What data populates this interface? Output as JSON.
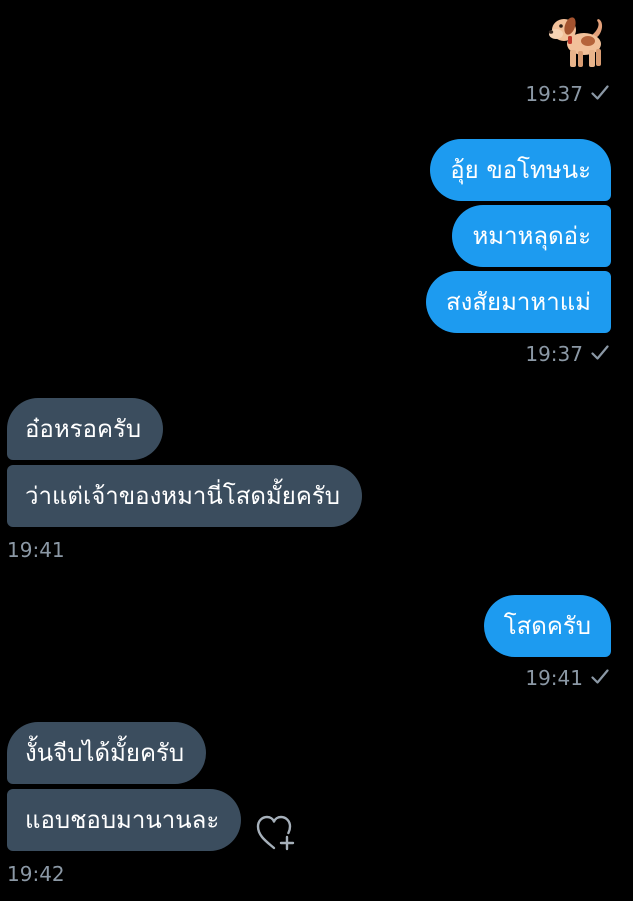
{
  "sticker": {
    "icon": "dog-emoji-icon"
  },
  "groups": [
    {
      "time": "19:37",
      "read": true
    },
    {
      "messages": [
        "อุ้ย ขอโทษนะ",
        "หมาหลุดอ่ะ",
        "สงสัยมาหาแม่"
      ],
      "time": "19:37",
      "read": true
    },
    {
      "messages": [
        "อ๋อหรอครับ",
        "ว่าแต่เจ้าของหมานี่โสดมั้ยครับ"
      ],
      "time": "19:41"
    },
    {
      "messages": [
        "โสดครับ"
      ],
      "time": "19:41",
      "read": true
    },
    {
      "messages": [
        "งั้นจีบได้มั้ยครับ",
        "แอบชอบมานานละ"
      ],
      "time": "19:42"
    }
  ],
  "reaction": {
    "icon": "heart-plus-icon"
  },
  "colors": {
    "background": "#000000",
    "outgoing_bubble": "#1d9bf0",
    "incoming_bubble": "#3b4d5e",
    "timestamp": "#8b98a5"
  }
}
